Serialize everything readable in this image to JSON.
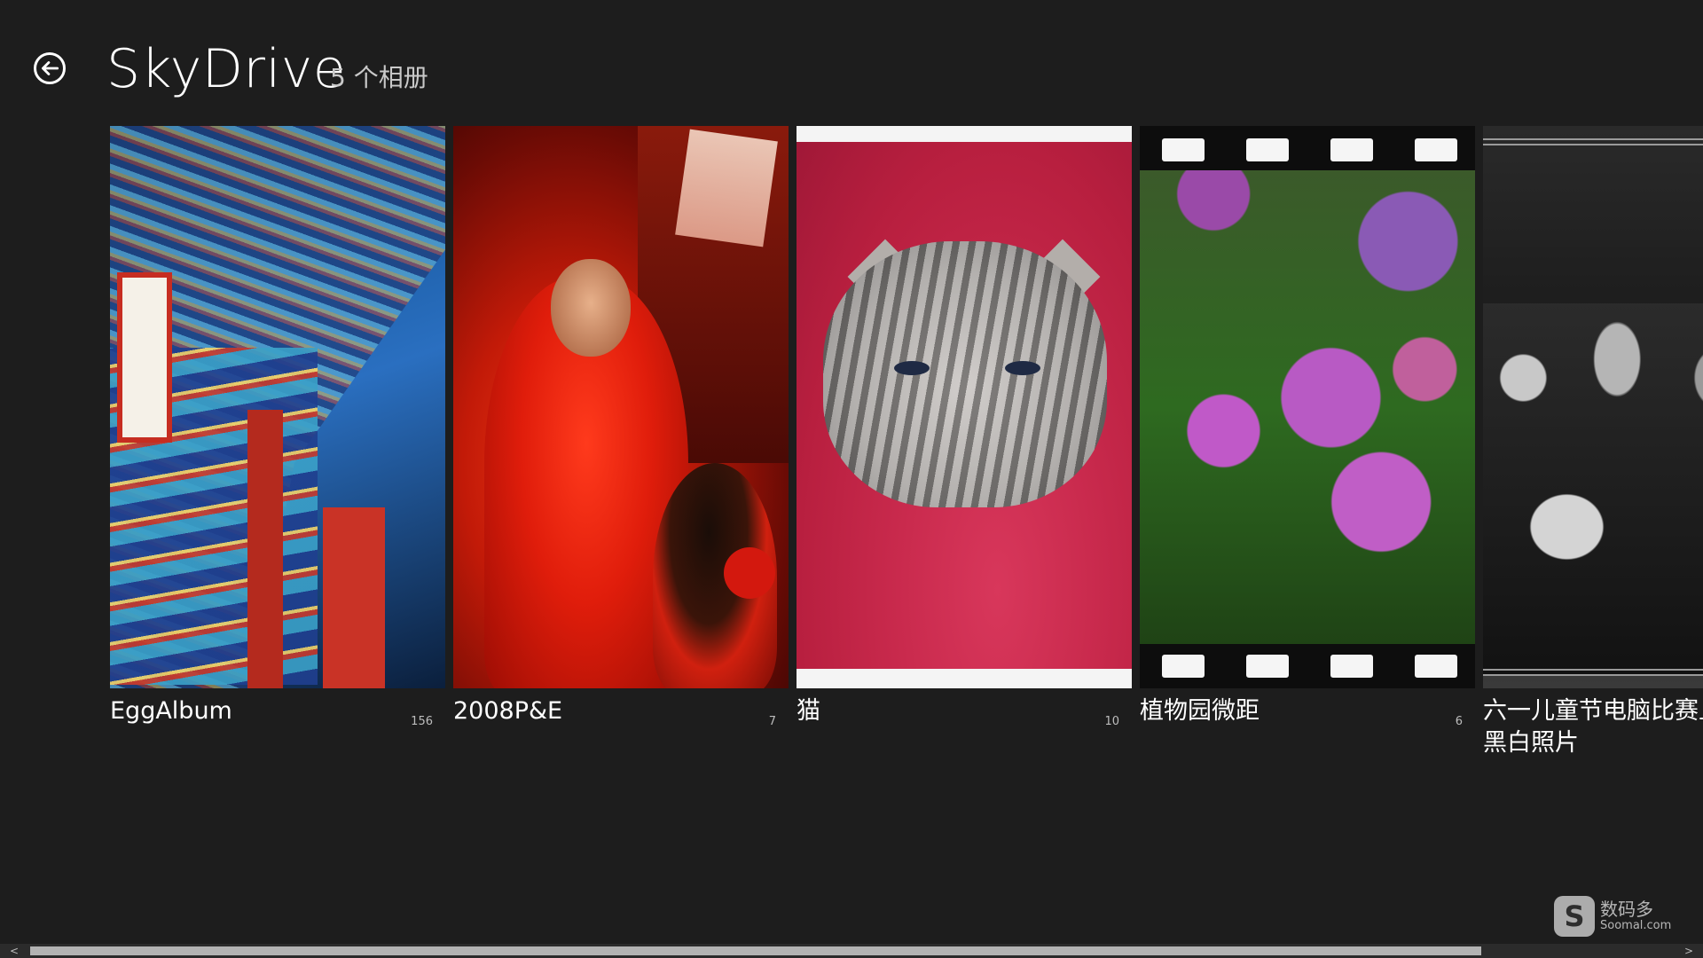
{
  "header": {
    "title": "SkyDrive",
    "subtitle": "5 个相册"
  },
  "albums": [
    {
      "name": "EggAlbum",
      "count": "156"
    },
    {
      "name": "2008P&E",
      "count": "7"
    },
    {
      "name": "猫",
      "count": "10"
    },
    {
      "name": "植物园微距",
      "count": "6"
    },
    {
      "name": "六一儿童节电脑比赛上的一组黑白照片",
      "count": ""
    }
  ],
  "scrollbar": {
    "left_arrow": "<",
    "right_arrow": ">"
  },
  "watermark": {
    "logo": "S",
    "text_cn": "数码多",
    "text_en": "Soomal.com"
  }
}
